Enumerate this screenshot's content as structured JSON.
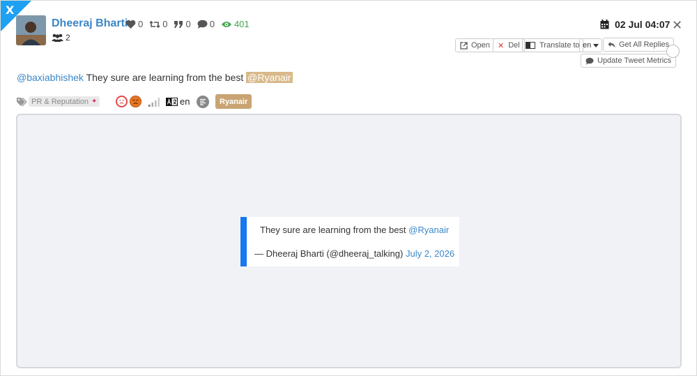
{
  "network_badge": "X",
  "author": {
    "name": "Dheeraj Bharti",
    "followers": "2"
  },
  "stats": {
    "likes": "0",
    "retweets": "0",
    "quotes": "0",
    "replies": "0",
    "views": "401"
  },
  "date": "02 Jul 04:07",
  "actions": {
    "open": "Open",
    "del": "Del",
    "translate_to": "Translate to",
    "language": "en",
    "get_all_replies": "Get All Replies",
    "update_metrics": "Update Tweet Metrics"
  },
  "tweet": {
    "mention1": "@baxiabhishek",
    "body": " They sure are learning from the best ",
    "mention2": "@Ryanair"
  },
  "tags": {
    "category": "PR & Reputation",
    "language": "en",
    "brand": "Ryanair"
  },
  "embed": {
    "text": "They sure are learning from the best ",
    "mention": "@Ryanair",
    "byline": "— Dheeraj Bharti (@dheeraj_talking) ",
    "date_link": "July 2, 2026"
  },
  "colors": {
    "accent_blue": "#3a87c8",
    "twitter_blue": "#1da1f2",
    "views_green": "#3fa34d",
    "brand_chip": "#c9a472",
    "embed_border": "#1877f2"
  }
}
